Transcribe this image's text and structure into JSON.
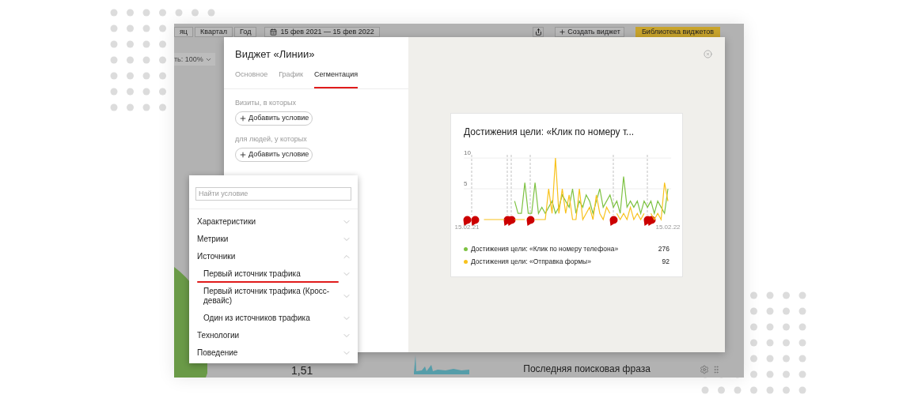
{
  "background": {
    "period_buttons": [
      "яц",
      "Квартал",
      "Год"
    ],
    "date_range": "15 фев 2021 — 15 фев 2022",
    "create_button": "Создать виджет",
    "library_button": "Библиотека виджетов",
    "scale_label": "ть: 100%",
    "metric_value": "1,51",
    "widget_title": "Последняя поисковая фраза"
  },
  "modal": {
    "title": "Виджет «Линии»",
    "tabs": [
      {
        "label": "Основное",
        "selected": false
      },
      {
        "label": "График",
        "selected": false
      },
      {
        "label": "Сегментация",
        "selected": true
      }
    ],
    "sections": [
      {
        "label": "Визиты, в которых",
        "button": "Добавить условие"
      },
      {
        "label": "для людей, у которых",
        "button": "Добавить условие"
      }
    ]
  },
  "dropdown": {
    "search": {
      "placeholder": "Найти условие"
    },
    "items": [
      {
        "label": "Характеристики",
        "expanded": false
      },
      {
        "label": "Метрики",
        "expanded": false
      },
      {
        "label": "Источники",
        "expanded": true,
        "children": [
          {
            "label": "Первый источник трафика",
            "expanded": false,
            "highlighted": true
          },
          {
            "label": "Первый источник трафика (Кросс-девайс)",
            "expanded": false,
            "highlighted": false
          },
          {
            "label": "Один из источников трафика",
            "expanded": false,
            "highlighted": false
          }
        ]
      },
      {
        "label": "Технологии",
        "expanded": false
      },
      {
        "label": "Поведение",
        "expanded": false
      }
    ]
  },
  "preview": {
    "title": "Достижения цели: «Клик по номеру т...",
    "chart_data": {
      "type": "line",
      "grid": true,
      "ylim": [
        -9.4,
        17.3
      ],
      "yticks": [
        5,
        10
      ],
      "categories": [
        "15.02.21",
        null,
        null,
        null,
        null,
        null,
        null,
        null,
        null,
        null,
        null,
        null,
        null,
        null,
        null,
        null,
        null,
        null,
        null,
        null,
        null,
        null,
        null,
        null,
        null,
        null,
        null,
        null,
        null,
        null,
        null,
        null,
        null,
        null,
        null,
        null,
        null,
        null,
        null,
        null,
        null,
        null,
        null,
        null,
        null,
        null,
        null,
        null,
        null,
        null,
        null,
        null,
        null,
        null,
        null,
        null,
        null,
        null,
        null,
        "15.02.22"
      ],
      "series": [
        {
          "name": "Достижения цели: «Клик по номеру телефона»",
          "color": "#7dc242",
          "values": [
            null,
            null,
            null,
            null,
            null,
            null,
            null,
            null,
            null,
            null,
            null,
            null,
            null,
            null,
            3,
            1,
            1,
            6,
            1,
            1,
            6,
            1,
            2,
            1,
            2,
            3,
            1,
            2,
            4,
            3,
            2,
            5,
            1,
            3,
            2,
            4,
            3,
            1,
            3,
            5,
            2,
            3,
            4,
            2,
            3,
            1,
            7,
            2,
            3,
            2,
            3,
            1,
            3,
            2,
            3,
            1,
            3,
            2,
            1,
            5
          ]
        },
        {
          "name": "Достижения цели: «Отправка формы»",
          "color": "#f8c21c",
          "values": [
            null,
            null,
            null,
            null,
            null,
            0,
            0,
            0,
            0,
            0,
            0,
            0,
            null,
            null,
            0,
            0,
            0,
            0,
            null,
            null,
            0,
            0,
            0,
            0,
            5,
            1,
            10,
            1,
            5,
            1,
            4,
            0,
            0,
            5,
            0,
            1,
            2,
            0,
            4,
            1,
            0,
            2,
            1,
            null,
            1,
            0,
            1,
            0,
            2,
            0,
            1,
            0,
            1,
            null,
            1,
            0,
            1,
            0,
            6,
            3
          ]
        }
      ]
    },
    "legend_totals": [
      "276",
      "92"
    ]
  }
}
